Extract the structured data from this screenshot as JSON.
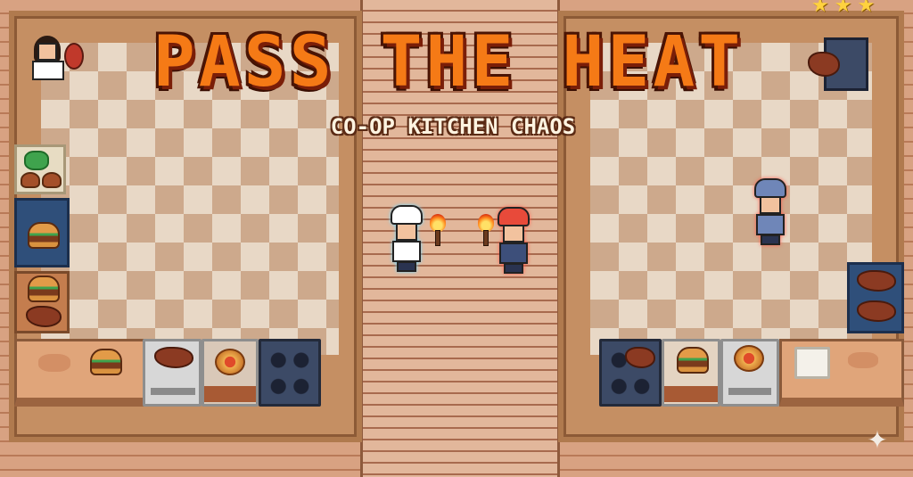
{
  "game": {
    "title": "PASS THE HEAT",
    "subtitle": "CO-OP KITCHEN CHAOS"
  },
  "hud": {
    "stars": [
      "★",
      "★",
      "★"
    ],
    "star_color": "#ffd23f"
  },
  "colors": {
    "title_orange": "#f57a16",
    "floor_light": "#e8d8c6",
    "floor_dark": "#cda98c",
    "wood": "#c58f63",
    "white_chef_outline": "#6fd7ff",
    "red_chef_outline": "#ff5a4a",
    "blue_chef": "#6f86b8"
  },
  "icons": {
    "sparkle": "✦"
  }
}
